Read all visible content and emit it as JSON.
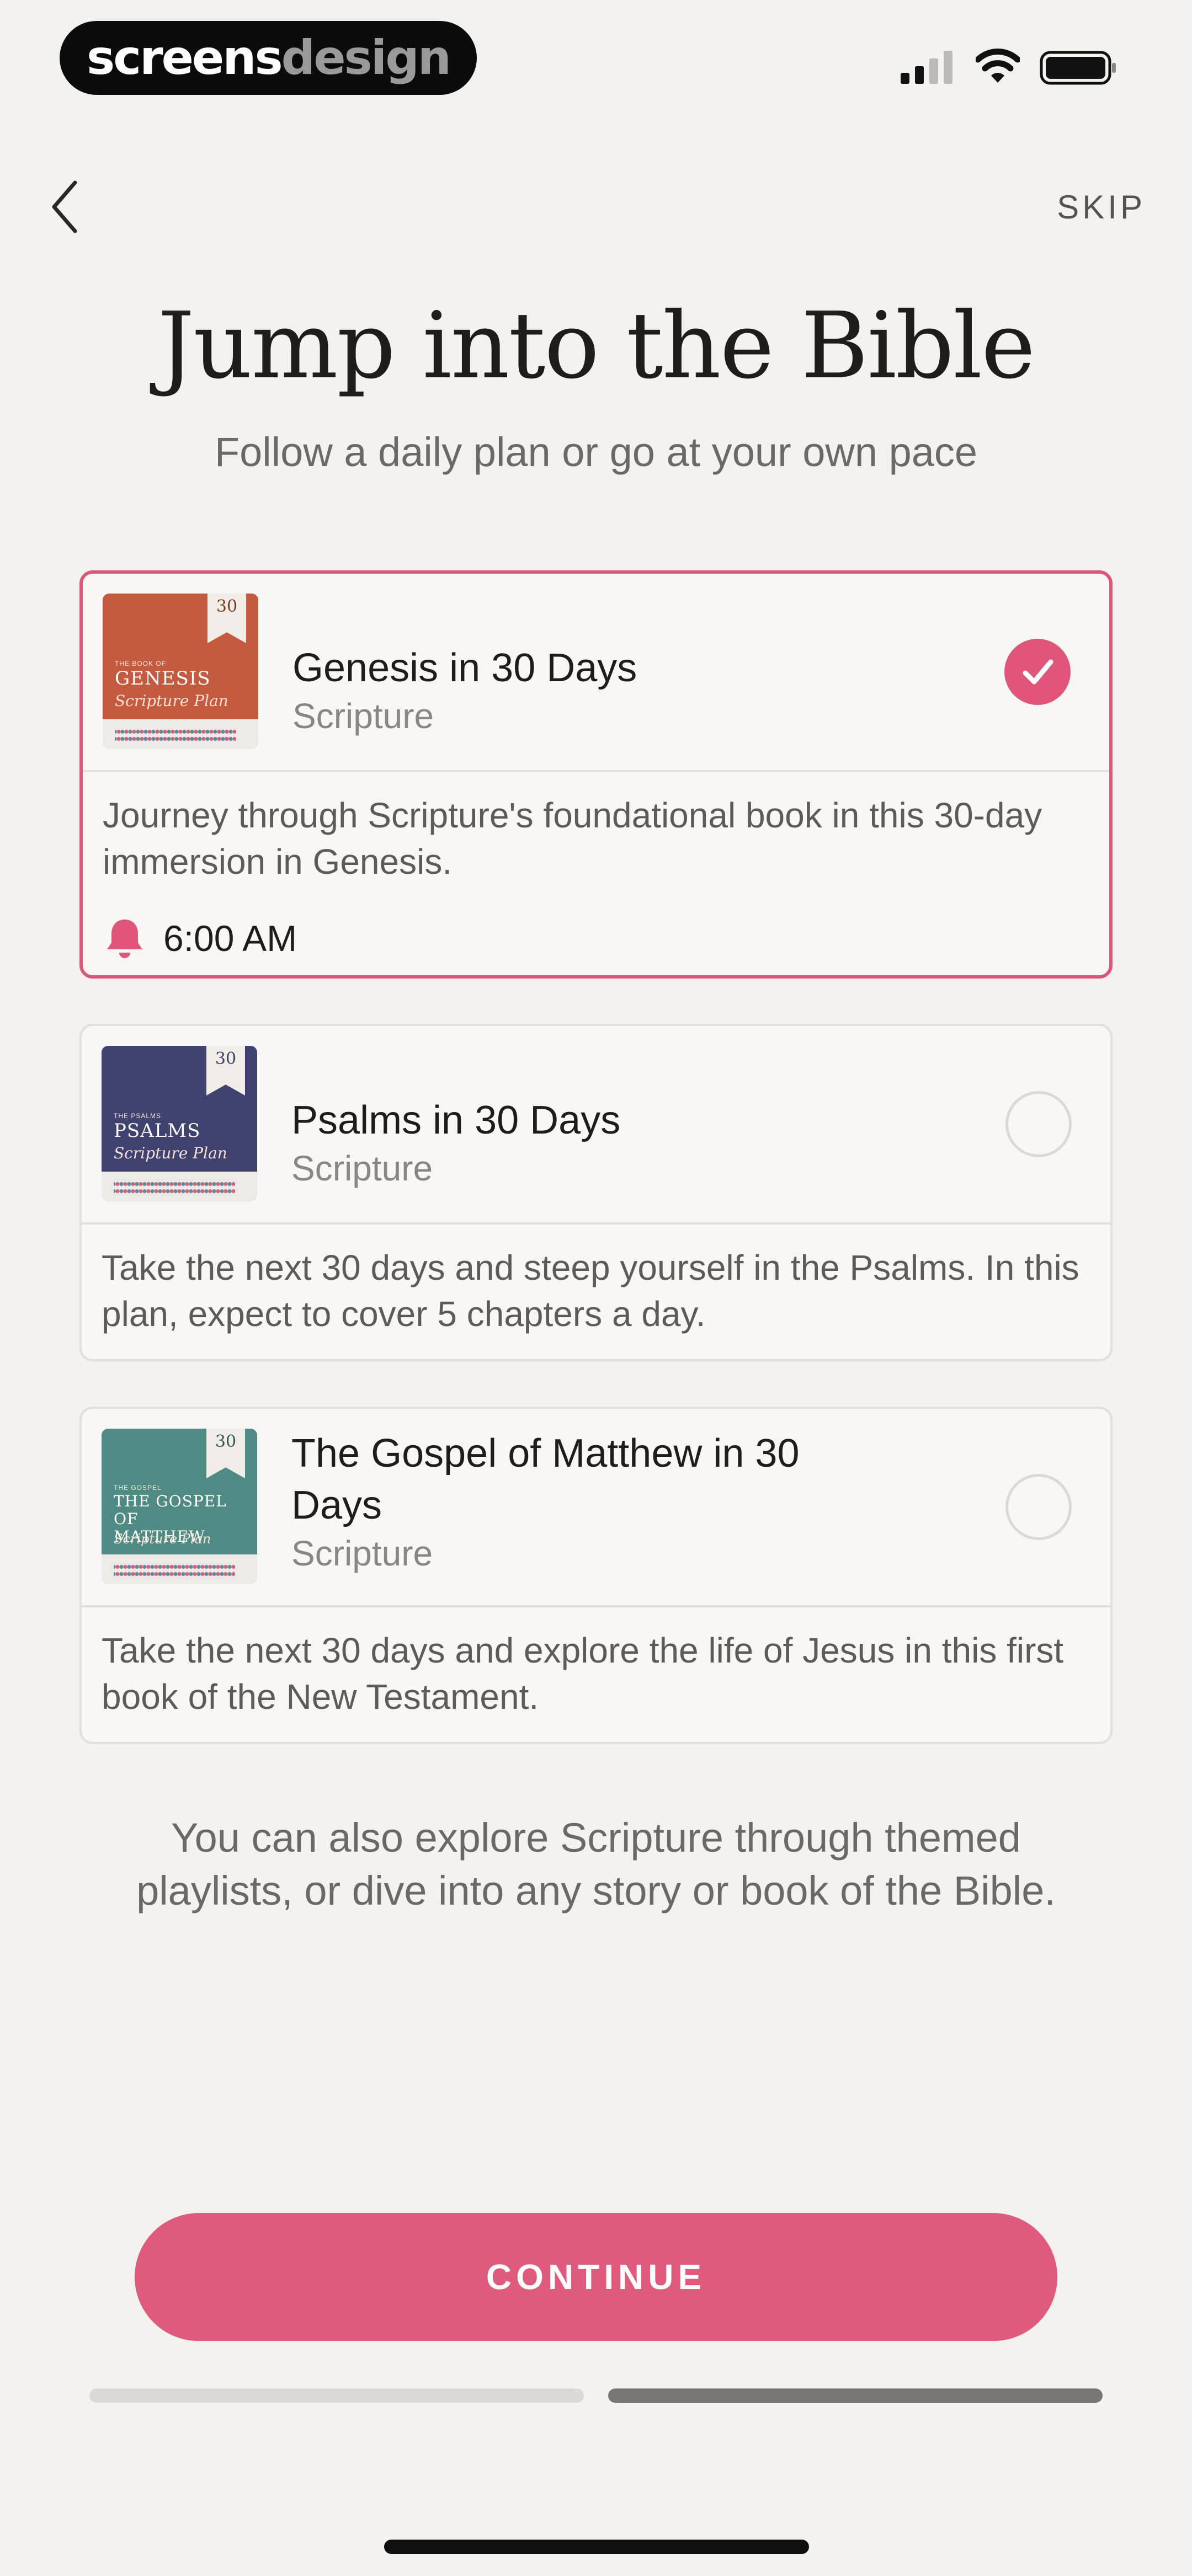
{
  "status_bar": {
    "logo_part1": "screens",
    "logo_part2": "design",
    "icons": [
      "signal-icon",
      "wifi-icon",
      "battery-icon"
    ]
  },
  "nav": {
    "back_icon": "chevron-left-icon",
    "skip_label": "SKIP"
  },
  "header": {
    "title": "Jump into the Bible",
    "subtitle": "Follow a daily plan or go at your own pace"
  },
  "plans": [
    {
      "title": "Genesis in 30 Days",
      "category": "Scripture",
      "description": "Journey through Scripture's foundational book in this 30-day immersion in Genesis.",
      "selected": true,
      "reminder_time": "6:00 AM",
      "cover": {
        "ribbon": "30",
        "small": "THE BOOK OF",
        "title": "GENESIS",
        "sub": "Scripture Plan",
        "color": "#c45a3f"
      }
    },
    {
      "title": "Psalms in 30 Days",
      "category": "Scripture",
      "description": "Take the next 30 days and steep yourself in the Psalms. In this plan, expect to cover 5 chapters a day.",
      "selected": false,
      "cover": {
        "ribbon": "30",
        "small": "THE PSALMS",
        "title": "PSALMS",
        "sub": "Scripture Plan",
        "color": "#3f416e"
      }
    },
    {
      "title": "The Gospel of Matthew in 30 Days",
      "category": "Scripture",
      "description": "Take the next 30 days and explore the life of Jesus in this first book of the New Testament.",
      "selected": false,
      "cover": {
        "ribbon": "30",
        "small": "THE GOSPEL",
        "title": "THE GOSPEL OF MATTHEW",
        "sub": "Scripture Plan",
        "color": "#4f8b83"
      }
    }
  ],
  "footnote": "You can also explore Scripture through themed playlists, or dive into any story or book of the Bible.",
  "continue_label": "CONTINUE",
  "progress": {
    "step": 2,
    "total": 2
  },
  "colors": {
    "accent": "#df5a7b",
    "background": "#f4f2ef",
    "card": "#f8f7f5"
  }
}
